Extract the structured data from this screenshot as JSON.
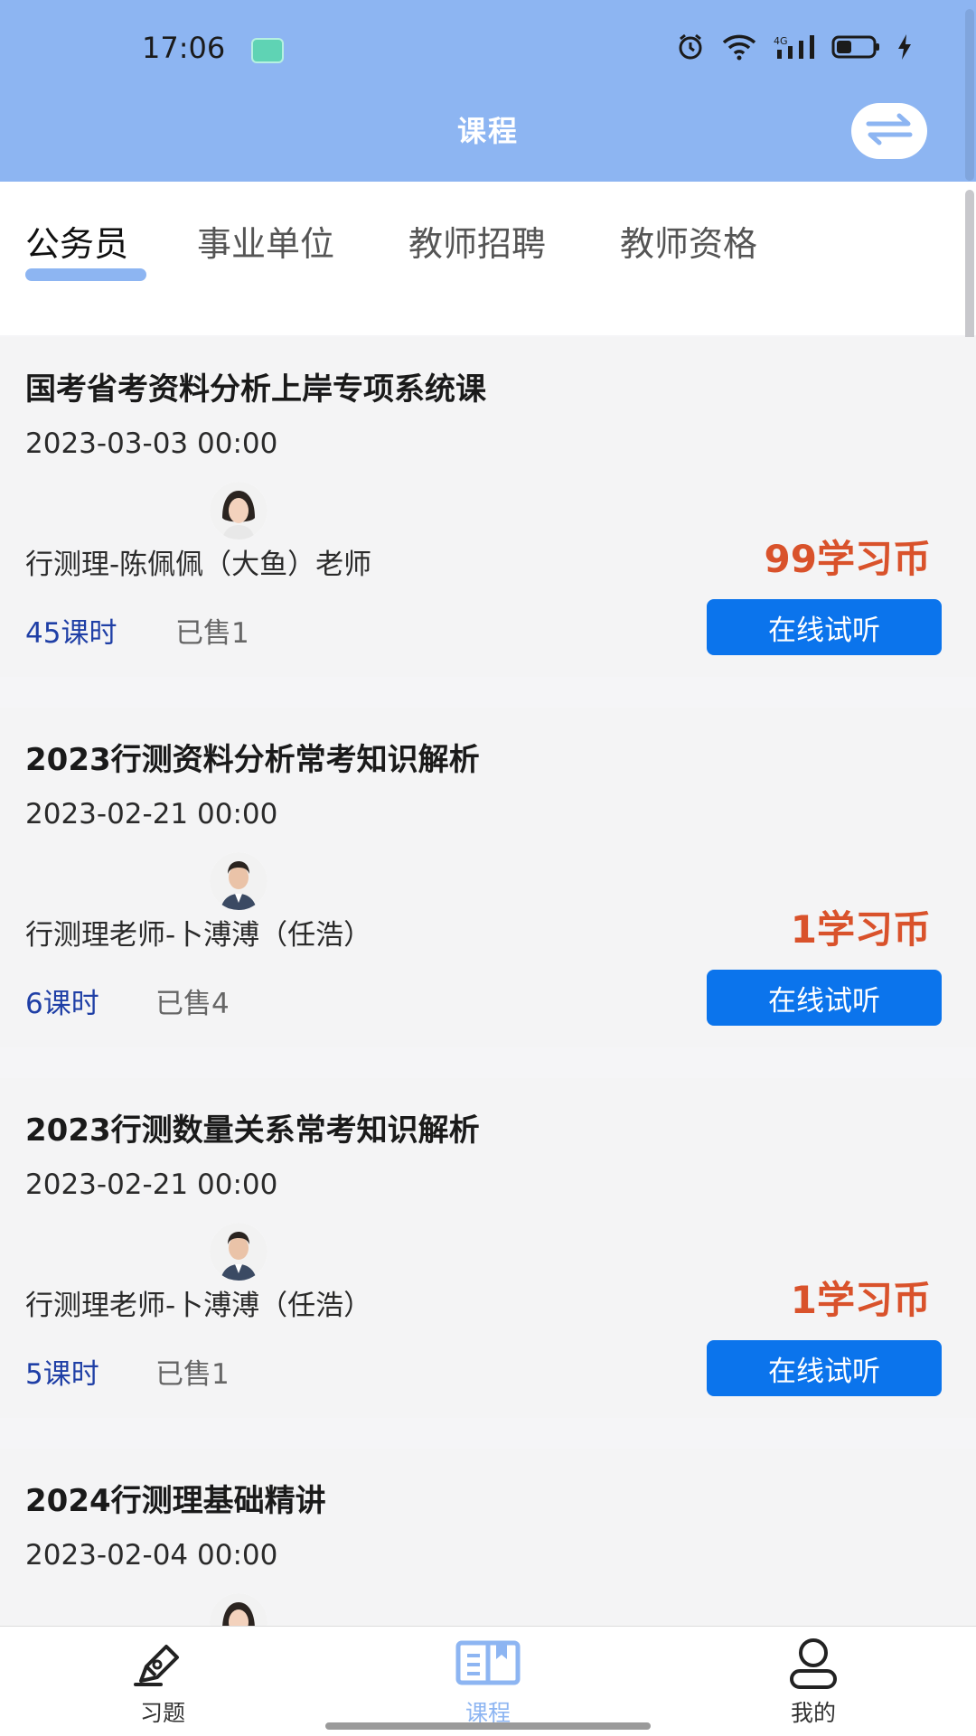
{
  "status_bar": {
    "time": "17:06"
  },
  "header": {
    "title": "课程"
  },
  "tabs": [
    {
      "label": "公务员",
      "active": true
    },
    {
      "label": "事业单位",
      "active": false
    },
    {
      "label": "教师招聘",
      "active": false
    },
    {
      "label": "教师资格",
      "active": false
    }
  ],
  "courses": [
    {
      "title": "国考省考资料分析上岸专项系统课",
      "date": "2023-03-03 00:00",
      "teacher": "行测理-陈佩佩（大鱼）老师",
      "price": "99学习币",
      "hours": "45课时",
      "sold": "已售1",
      "button": "在线试听",
      "avatar": "female-teacher-avatar"
    },
    {
      "title": "2023行测资料分析常考知识解析",
      "date": "2023-02-21 00:00",
      "teacher": "行测理老师-卜溥溥（任浩）",
      "price": "1学习币",
      "hours": "6课时",
      "sold": "已售4",
      "button": "在线试听",
      "avatar": "male-teacher-avatar"
    },
    {
      "title": "2023行测数量关系常考知识解析",
      "date": "2023-02-21 00:00",
      "teacher": "行测理老师-卜溥溥（任浩）",
      "price": "1学习币",
      "hours": "5课时",
      "sold": "已售1",
      "button": "在线试听",
      "avatar": "male-teacher-avatar"
    },
    {
      "title": "2024行测理基础精讲",
      "date": "2023-02-04 00:00",
      "avatar": "female-teacher-avatar"
    }
  ],
  "bottom_nav": [
    {
      "label": "习题",
      "icon": "pen-icon",
      "active": false
    },
    {
      "label": "课程",
      "icon": "book-icon",
      "active": true
    },
    {
      "label": "我的",
      "icon": "user-icon",
      "active": false
    }
  ],
  "colors": {
    "header_bg": "#8db5f2",
    "price": "#d9522b",
    "hours": "#1f3fa6",
    "button_bg": "#0b74ec",
    "tab_indicator": "#8db5f2"
  }
}
